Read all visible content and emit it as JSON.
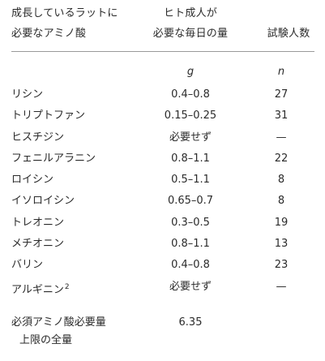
{
  "header": {
    "col1_line1": "成長しているラットに",
    "col1_line2": "必要なアミノ酸",
    "col2_line1": "ヒト成人が",
    "col2_line2": "必要な毎日の量",
    "col3": "試験人数"
  },
  "units": {
    "amount": "g",
    "count": "n"
  },
  "rows": [
    {
      "name": "リシン",
      "amount": "0.4–0.8",
      "count": "27"
    },
    {
      "name": "トリプトファン",
      "amount": "0.15–0.25",
      "count": "31"
    },
    {
      "name": "ヒスチジン",
      "amount": "必要せず",
      "count": "—"
    },
    {
      "name": "フェニルアラニン",
      "amount": "0.8–1.1",
      "count": "22"
    },
    {
      "name": "ロイシン",
      "amount": "0.5–1.1",
      "count": "8"
    },
    {
      "name": "イソロイシン",
      "amount": "0.65–0.7",
      "count": "8"
    },
    {
      "name": "トレオニン",
      "amount": "0.3–0.5",
      "count": "19"
    },
    {
      "name": "メチオニン",
      "amount": "0.8–1.1",
      "count": "13"
    },
    {
      "name": "バリン",
      "amount": "0.4–0.8",
      "count": "23"
    },
    {
      "name": "アルギニン",
      "superscript": "2",
      "amount": "必要せず",
      "count": "—"
    }
  ],
  "total": {
    "label_line1": "必須アミノ酸必要量",
    "label_line2": "上限の全量",
    "amount": "6.35"
  }
}
